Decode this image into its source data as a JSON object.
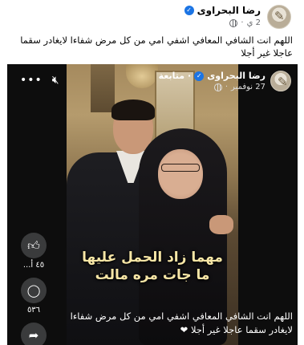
{
  "post": {
    "author_name": "رضا البحراوى",
    "time": "2 ي",
    "text": "اللهم انت الشافي المعافي اشفي امي من كل مرض شفاءا لايغادر سقما عاجلا غير أجلا"
  },
  "reel": {
    "author_name": "رضا البحراوى",
    "follow_label": "متابعة",
    "date": "27 نوفمبر",
    "overlay_line1": "مهما زاد الحمل عليها",
    "overlay_line2": "ما جات مره مالت",
    "caption": "اللهم انت الشافي المعافي اشفي امي من كل مرض شفاءا لايغادر سقما عاجلا غير أجلا ❤",
    "likes_count": "٤٥ أ...",
    "comments_count": "٥٣٦"
  },
  "icons": {
    "verified": "verified-badge-icon",
    "globe": "globe-icon",
    "mute": "speaker-muted-icon",
    "more": "more-options-icon",
    "like": "thumbs-up-icon",
    "comment": "comment-bubble-icon",
    "share": "share-arrow-icon"
  },
  "colors": {
    "verified_blue": "#1b74e4",
    "overlay_text": "#f7e6a6",
    "reel_background": "#0d0d0d"
  }
}
